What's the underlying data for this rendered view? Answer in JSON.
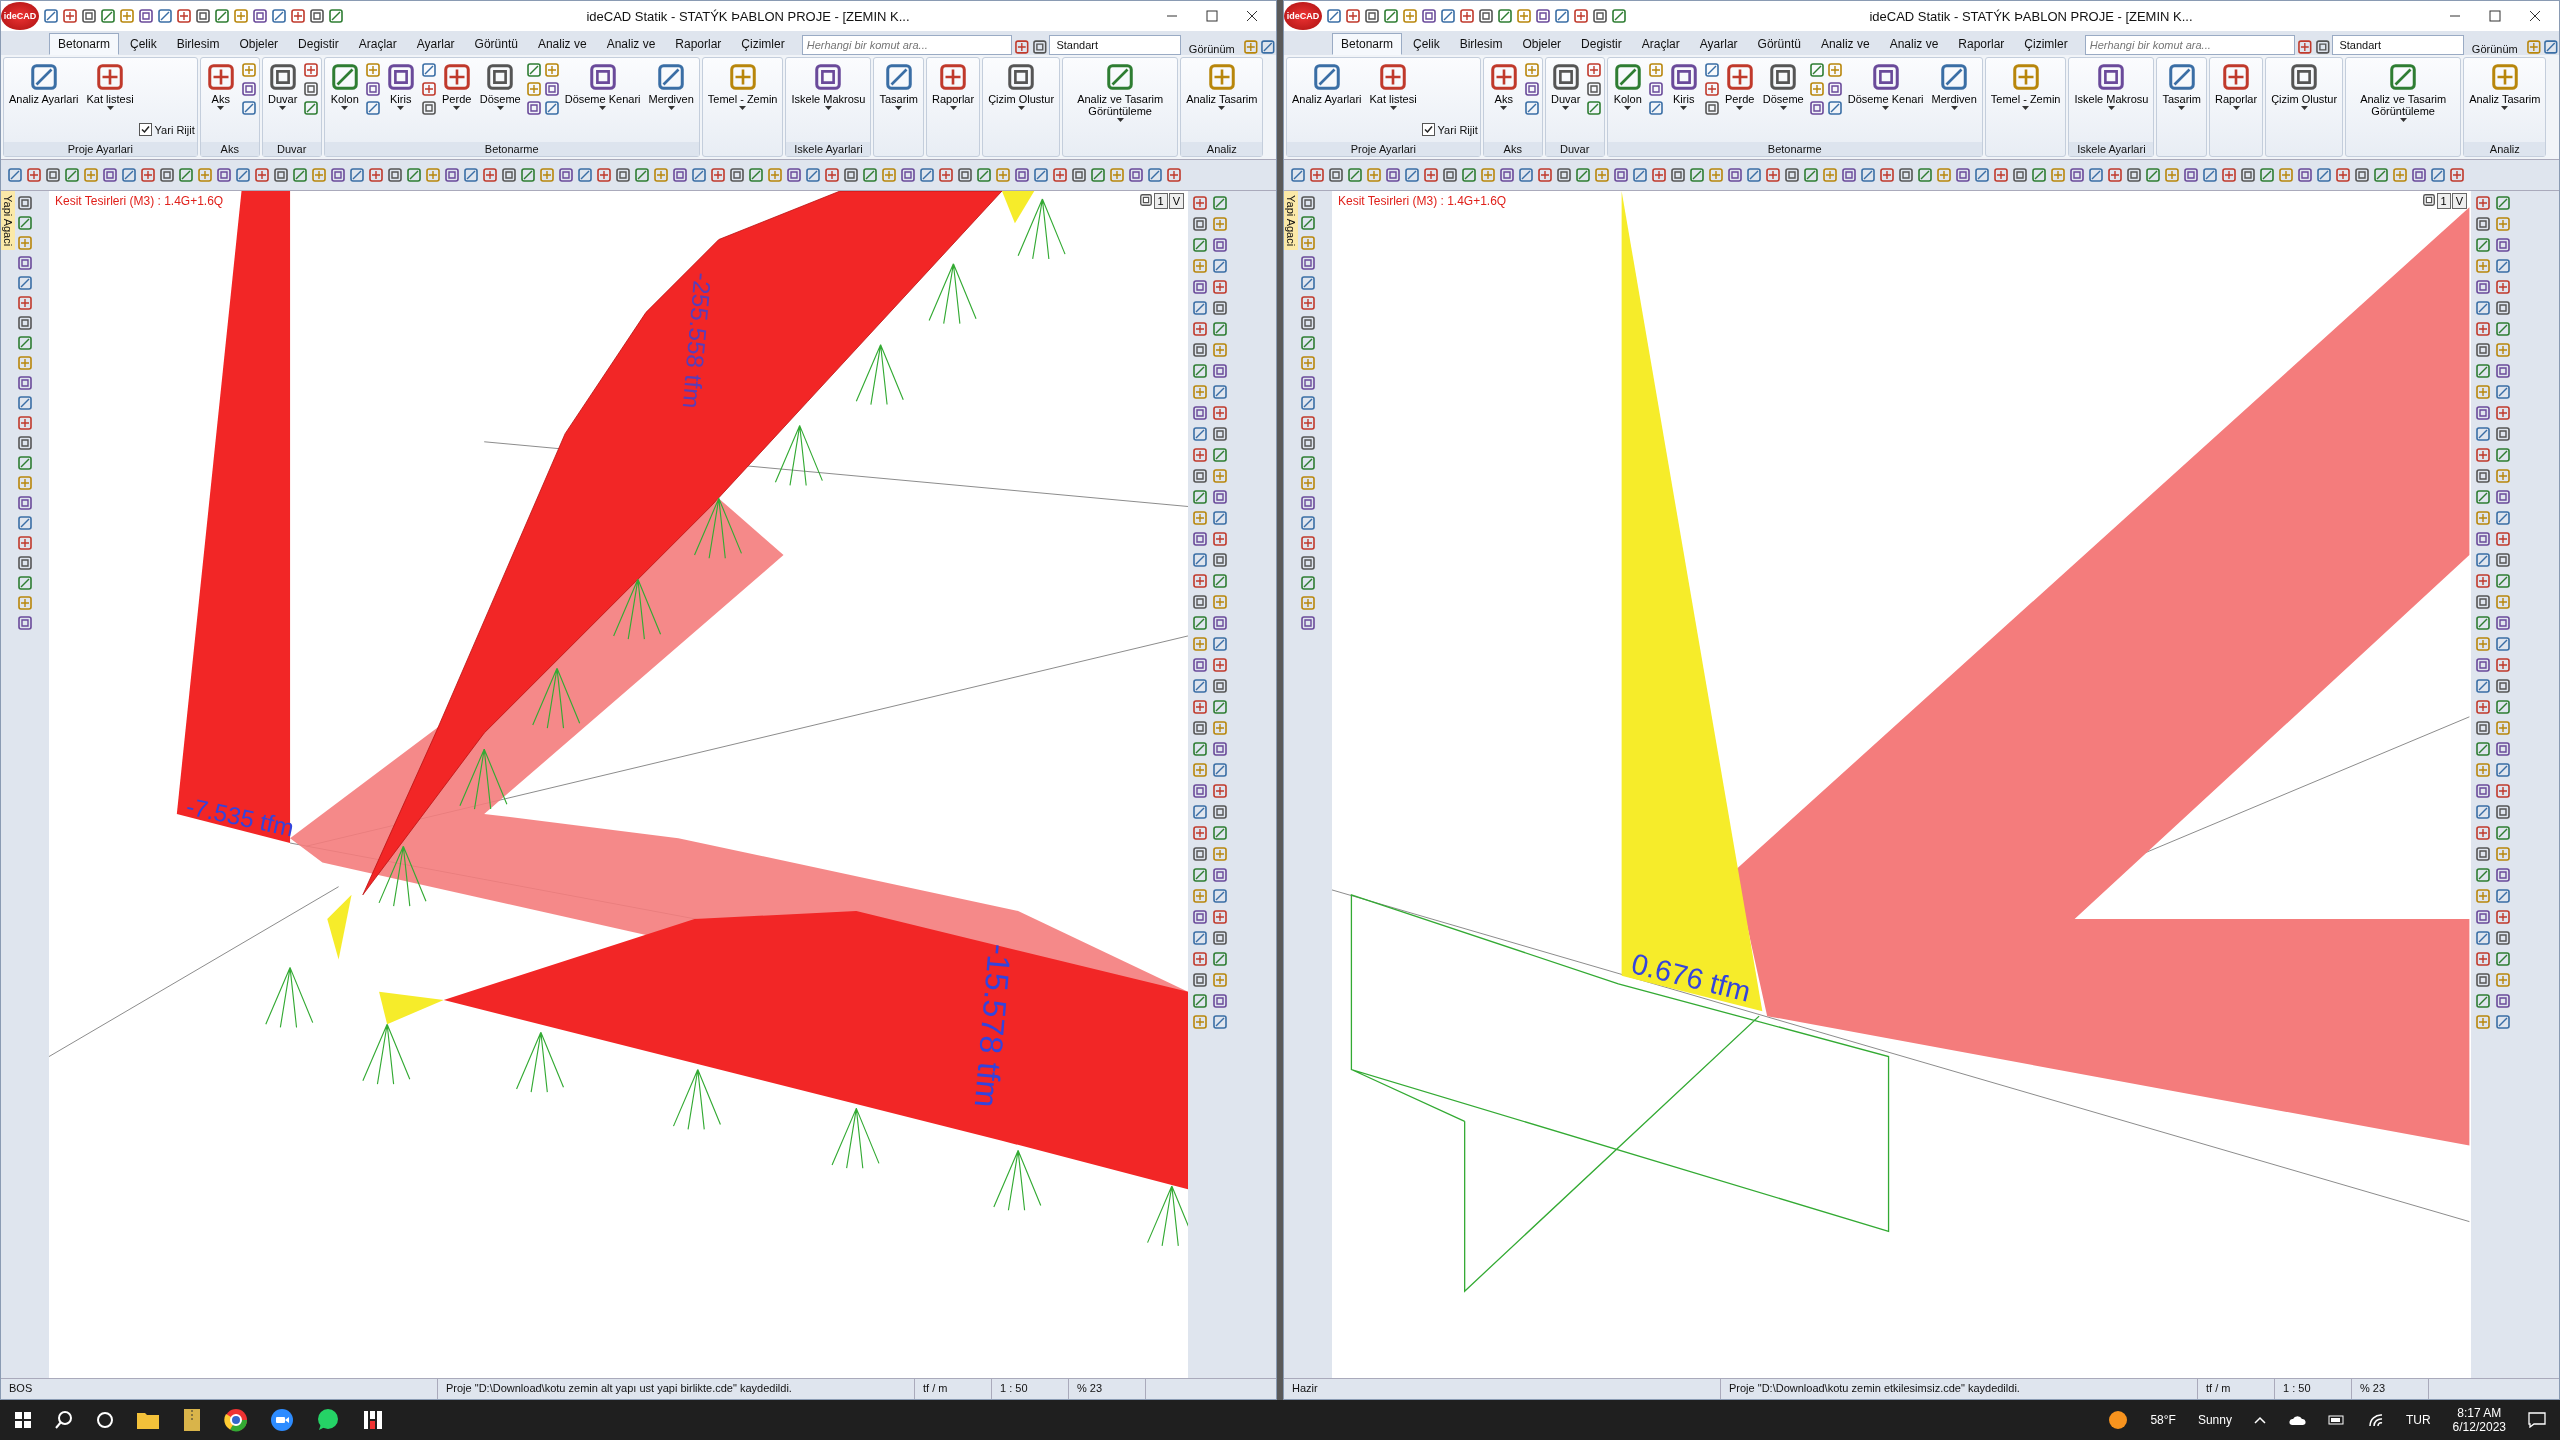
{
  "windows": [
    {
      "logo": "ideCAD",
      "title": "ideCAD Statik - STATÝK ÞABLON PROJE - [ZEMIN K...",
      "tabs": [
        {
          "label": "Betonarm",
          "selected": true
        },
        {
          "label": "Çelik",
          "selected": false
        },
        {
          "label": "Birlesim",
          "selected": false
        },
        {
          "label": "Objeler",
          "selected": false
        },
        {
          "label": "Degistir",
          "selected": false
        },
        {
          "label": "Araçlar",
          "selected": false
        },
        {
          "label": "Ayarlar",
          "selected": false
        },
        {
          "label": "Görüntü",
          "selected": false
        },
        {
          "label": "Analiz ve",
          "selected": false
        },
        {
          "label": "Analiz ve",
          "selected": false
        },
        {
          "label": "Raporlar",
          "selected": false
        },
        {
          "label": "Çizimler",
          "selected": false
        }
      ],
      "search": {
        "placeholder": "Herhangi bir komut ara..."
      },
      "style_box": "Standart",
      "view_menu": "Görünüm",
      "ribbon": [
        {
          "label": "Proje Ayarlari",
          "items": [
            {
              "kind": "big",
              "label": "Analiz Ayarlari",
              "dropdown": false
            },
            {
              "kind": "big",
              "label": "Kat listesi",
              "dropdown": true
            },
            {
              "kind": "check",
              "label": "Yari Rijit",
              "checked": true
            }
          ]
        },
        {
          "label": "Aks",
          "items": [
            {
              "kind": "big",
              "label": "Aks",
              "dropdown": true
            },
            {
              "kind": "icons"
            }
          ]
        },
        {
          "label": "Duvar",
          "items": [
            {
              "kind": "big",
              "label": "Duvar",
              "dropdown": true
            },
            {
              "kind": "icons"
            }
          ]
        },
        {
          "label": "Betonarme",
          "items": [
            {
              "kind": "big",
              "label": "Kolon",
              "dropdown": true
            },
            {
              "kind": "icons"
            },
            {
              "kind": "big",
              "label": "Kiris",
              "dropdown": true
            },
            {
              "kind": "icons"
            },
            {
              "kind": "big",
              "label": "Perde",
              "dropdown": true
            },
            {
              "kind": "big",
              "label": "Döseme",
              "dropdown": true
            },
            {
              "kind": "icons"
            },
            {
              "kind": "icons"
            },
            {
              "kind": "big",
              "label": "Döseme Kenari",
              "dropdown": true
            },
            {
              "kind": "big",
              "label": "Merdiven",
              "dropdown": true
            }
          ]
        },
        {
          "items": [
            {
              "kind": "big",
              "label": "Temel - Zemin",
              "dropdown": true
            }
          ]
        },
        {
          "label": "Iskele Ayarlari",
          "items": [
            {
              "kind": "big",
              "label": "Iskele Makrosu",
              "dropdown": true
            }
          ]
        },
        {
          "items": [
            {
              "kind": "big",
              "label": "Tasarim",
              "dropdown": true
            }
          ]
        },
        {
          "items": [
            {
              "kind": "big",
              "label": "Raporlar",
              "dropdown": true
            }
          ]
        },
        {
          "items": [
            {
              "kind": "big",
              "label": "Çizim Olustur",
              "dropdown": true
            }
          ]
        },
        {
          "items": [
            {
              "kind": "big",
              "label": "Analiz ve Tasarim Görüntüleme",
              "dropdown": true
            }
          ]
        },
        {
          "label": "Analiz",
          "items": [
            {
              "kind": "big",
              "label": "Analiz Tasarim",
              "dropdown": true
            }
          ]
        }
      ],
      "viewport": {
        "caption": "Kesit Tesirleri (M3) : 1.4G+1.6Q",
        "side_tab": "Yapi Agaci",
        "view_buttons": [
          "1",
          "V"
        ],
        "labels": [
          "-7.535 tfm",
          "-255.558 tfm",
          "-15.578 tfm"
        ]
      },
      "status": [
        "BOS",
        "Proje \"D:\\Download\\kotu zemin alt yapı ust yapi birlikte.cde\" kaydedildi.",
        "tf / m",
        "1 : 50",
        "% 23"
      ]
    },
    {
      "logo": "ideCAD",
      "title": "ideCAD Statik - STATÝK ÞABLON PROJE - [ZEMIN K...",
      "tabs": [
        {
          "label": "Betonarm",
          "selected": true
        },
        {
          "label": "Çelik",
          "selected": false
        },
        {
          "label": "Birlesim",
          "selected": false
        },
        {
          "label": "Objeler",
          "selected": false
        },
        {
          "label": "Degistir",
          "selected": false
        },
        {
          "label": "Araçlar",
          "selected": false
        },
        {
          "label": "Ayarlar",
          "selected": false
        },
        {
          "label": "Görüntü",
          "selected": false
        },
        {
          "label": "Analiz ve",
          "selected": false
        },
        {
          "label": "Analiz ve",
          "selected": false
        },
        {
          "label": "Raporlar",
          "selected": false
        },
        {
          "label": "Çizimler",
          "selected": false
        }
      ],
      "search": {
        "placeholder": "Herhangi bir komut ara..."
      },
      "style_box": "Standart",
      "view_menu": "Görünüm",
      "ribbon": [
        {
          "label": "Proje Ayarlari",
          "items": [
            {
              "kind": "big",
              "label": "Analiz Ayarlari",
              "dropdown": false
            },
            {
              "kind": "big",
              "label": "Kat listesi",
              "dropdown": true
            },
            {
              "kind": "check",
              "label": "Yari Rijit",
              "checked": true
            }
          ]
        },
        {
          "label": "Aks",
          "items": [
            {
              "kind": "big",
              "label": "Aks",
              "dropdown": true
            },
            {
              "kind": "icons"
            }
          ]
        },
        {
          "label": "Duvar",
          "items": [
            {
              "kind": "big",
              "label": "Duvar",
              "dropdown": true
            },
            {
              "kind": "icons"
            }
          ]
        },
        {
          "label": "Betonarme",
          "items": [
            {
              "kind": "big",
              "label": "Kolon",
              "dropdown": true
            },
            {
              "kind": "icons"
            },
            {
              "kind": "big",
              "label": "Kiris",
              "dropdown": true
            },
            {
              "kind": "icons"
            },
            {
              "kind": "big",
              "label": "Perde",
              "dropdown": true
            },
            {
              "kind": "big",
              "label": "Döseme",
              "dropdown": true
            },
            {
              "kind": "icons"
            },
            {
              "kind": "icons"
            },
            {
              "kind": "big",
              "label": "Döseme Kenari",
              "dropdown": true
            },
            {
              "kind": "big",
              "label": "Merdiven",
              "dropdown": true
            }
          ]
        },
        {
          "items": [
            {
              "kind": "big",
              "label": "Temel - Zemin",
              "dropdown": true
            }
          ]
        },
        {
          "label": "Iskele Ayarlari",
          "items": [
            {
              "kind": "big",
              "label": "Iskele Makrosu",
              "dropdown": true
            }
          ]
        },
        {
          "items": [
            {
              "kind": "big",
              "label": "Tasarim",
              "dropdown": true
            }
          ]
        },
        {
          "items": [
            {
              "kind": "big",
              "label": "Raporlar",
              "dropdown": true
            }
          ]
        },
        {
          "items": [
            {
              "kind": "big",
              "label": "Çizim Olustur",
              "dropdown": true
            }
          ]
        },
        {
          "items": [
            {
              "kind": "big",
              "label": "Analiz ve Tasarim Görüntüleme",
              "dropdown": true
            }
          ]
        },
        {
          "label": "Analiz",
          "items": [
            {
              "kind": "big",
              "label": "Analiz Tasarim",
              "dropdown": true
            }
          ]
        }
      ],
      "viewport": {
        "caption": "Kesit Tesirleri (M3) : 1.4G+1.6Q",
        "side_tab": "Yapi Agaci",
        "view_buttons": [
          "1",
          "V"
        ],
        "labels": [
          "0.676 tfm"
        ]
      },
      "status": [
        "Hazir",
        "Proje \"D:\\Download\\kotu zemin etkilesimsiz.cde\" kaydedildi.",
        "tf / m",
        "1 : 50",
        "% 23"
      ]
    }
  ],
  "taskbar": {
    "weather_temp": "58°F",
    "weather_text": "Sunny",
    "language": "TUR",
    "time": "8:17 AM",
    "date": "6/12/2023"
  }
}
